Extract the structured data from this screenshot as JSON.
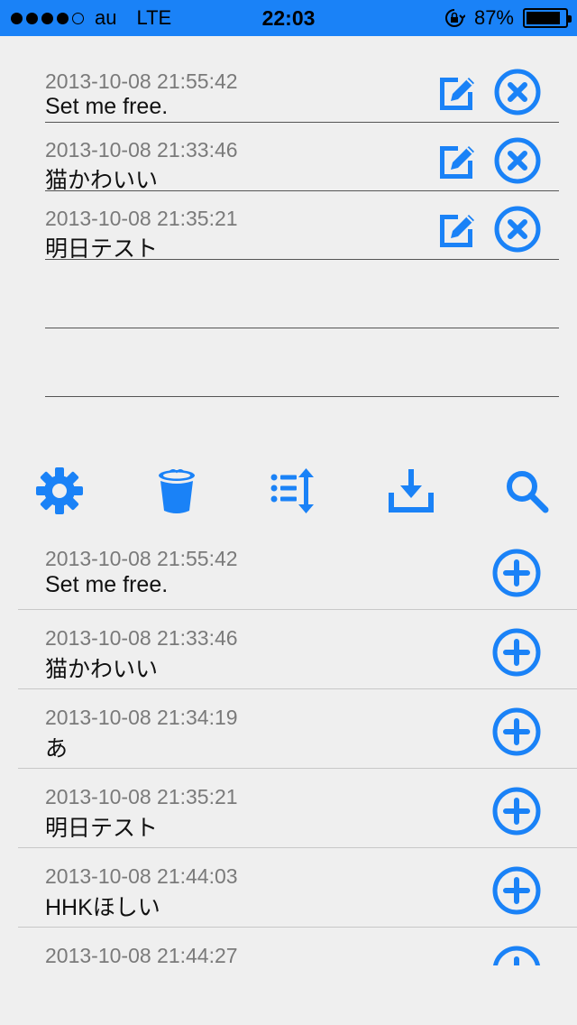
{
  "status_bar": {
    "carrier": "au",
    "network": "LTE",
    "time": "22:03",
    "battery_percent_label": "87%",
    "battery_level": 0.87,
    "signal_bars_filled": 4,
    "signal_bars_total": 5
  },
  "colors": {
    "accent": "#1a82f7",
    "background": "#efefef"
  },
  "top_list": {
    "items": [
      {
        "timestamp": "2013-10-08 21:55:42",
        "text": "Set me free."
      },
      {
        "timestamp": "2013-10-08 21:33:46",
        "text": "猫かわいい"
      },
      {
        "timestamp": "2013-10-08 21:35:21",
        "text": "明日テスト"
      },
      {
        "timestamp": "",
        "text": ""
      },
      {
        "timestamp": "",
        "text": ""
      }
    ]
  },
  "toolbar": {
    "icons": [
      "gear-icon",
      "trash-icon",
      "sort-list-icon",
      "download-icon",
      "search-icon"
    ]
  },
  "bottom_list": {
    "items": [
      {
        "timestamp": "2013-10-08 21:55:42",
        "text": "Set me free."
      },
      {
        "timestamp": "2013-10-08 21:33:46",
        "text": "猫かわいい"
      },
      {
        "timestamp": "2013-10-08 21:34:19",
        "text": "あ"
      },
      {
        "timestamp": "2013-10-08 21:35:21",
        "text": "明日テスト"
      },
      {
        "timestamp": "2013-10-08 21:44:03",
        "text": "HHKほしい"
      },
      {
        "timestamp": "2013-10-08 21:44:27",
        "text": ""
      }
    ]
  }
}
